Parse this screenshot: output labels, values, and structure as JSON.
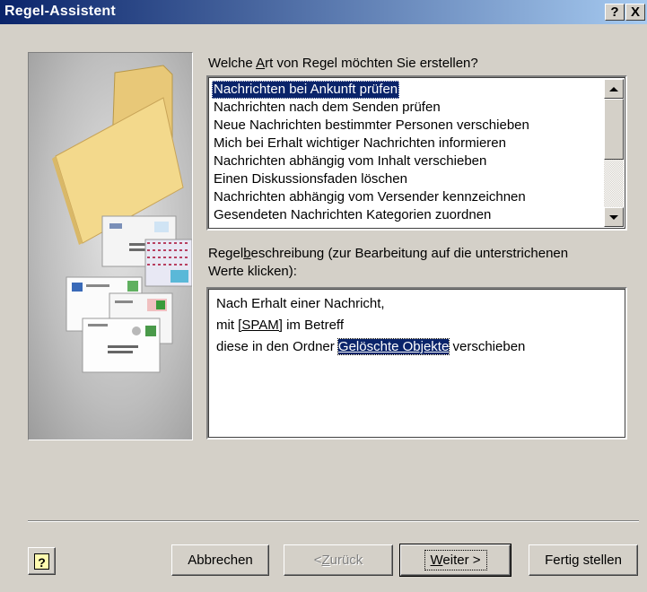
{
  "window": {
    "title": "Regel-Assistent",
    "help_glyph": "?",
    "close_glyph": "X"
  },
  "question": {
    "before": "Welche ",
    "mnemonic": "A",
    "after": "rt von Regel möchten Sie erstellen?"
  },
  "rules": [
    "Nachrichten bei Ankunft prüfen",
    "Nachrichten nach dem Senden prüfen",
    "Neue Nachrichten bestimmter Personen verschieben",
    "Mich bei Erhalt wichtiger Nachrichten informieren",
    "Nachrichten abhängig vom Inhalt verschieben",
    "Einen Diskussionsfaden löschen",
    "Nachrichten abhängig vom Versender kennzeichnen",
    "Gesendeten Nachrichten Kategorien zuordnen"
  ],
  "selected_rule_index": 0,
  "description_label": {
    "line1_before": "Regel",
    "line1_mnemonic": "b",
    "line1_after": "eschreibung (zur Bearbeitung auf die unterstrichenen",
    "line2": "Werte klicken):"
  },
  "description": {
    "line1": "Nach Erhalt einer Nachricht,",
    "line2_before": "mit ",
    "line2_link": "[SPAM]",
    "line2_after": " im Betreff",
    "line3_before": "diese in den Ordner ",
    "line3_link": "Gelöschte Objekte",
    "line3_after": " verschieben"
  },
  "buttons": {
    "help_glyph": "?",
    "cancel": "Abbrechen",
    "back_prefix": "< ",
    "back_mnemonic": "Z",
    "back_rest": "urück",
    "next_mnemonic": "W",
    "next_rest": "eiter >",
    "finish": "Fertig stellen"
  },
  "icons": [
    "folder-envelopes-illustration",
    "scroll-up-icon",
    "scroll-down-icon",
    "help-icon"
  ]
}
